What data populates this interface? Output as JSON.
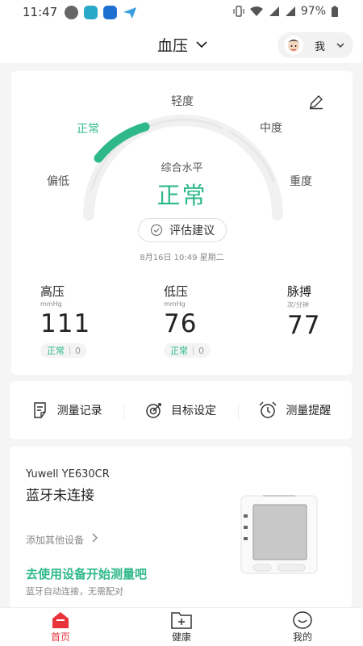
{
  "status_bar": {
    "time": "11:47",
    "battery": "97%"
  },
  "header": {
    "title": "血压",
    "user_label": "我"
  },
  "gauge": {
    "levels": [
      "偏低",
      "正常",
      "轻度",
      "中度",
      "重度"
    ],
    "active_level": "正常",
    "caption": "综合水平",
    "result": "正常",
    "eval_button": "评估建议",
    "timestamp": "8月16日 10:49 星期二"
  },
  "metrics": [
    {
      "label": "高压",
      "unit": "mmHg",
      "value": "111",
      "status": "正常",
      "count": "0"
    },
    {
      "label": "低压",
      "unit": "mmHg",
      "value": "76",
      "status": "正常",
      "count": "0"
    },
    {
      "label": "脉搏",
      "unit": "次/分钟",
      "value": "77"
    }
  ],
  "actions": [
    {
      "label": "测量记录",
      "icon": "record-icon"
    },
    {
      "label": "目标设定",
      "icon": "target-icon"
    },
    {
      "label": "测量提醒",
      "icon": "alarm-icon"
    }
  ],
  "device": {
    "model": "Yuwell YE630CR",
    "status": "蓝牙未连接",
    "add_link": "添加其他设备",
    "cta": "去使用设备开始测量吧",
    "tip": "蓝牙自动连接，无需配对"
  },
  "bottom_nav": [
    {
      "label": "首页",
      "icon": "home-icon",
      "active": true
    },
    {
      "label": "健康",
      "icon": "health-icon"
    },
    {
      "label": "我的",
      "icon": "profile-icon"
    }
  ],
  "colors": {
    "accent": "#2fb98a",
    "nav_active": "#e8333a"
  }
}
